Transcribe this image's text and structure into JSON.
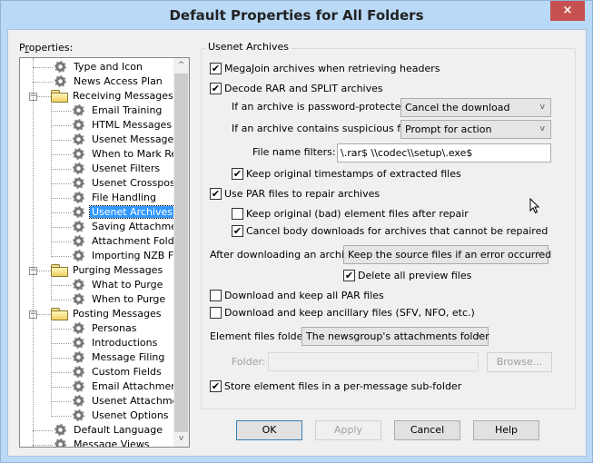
{
  "window": {
    "title": "Default Properties for All Folders",
    "close_label": "×"
  },
  "tree": {
    "label_prefix": "P",
    "label_underlined": "r",
    "label_suffix": "operties:",
    "items": [
      {
        "label": "Type and Icon",
        "icon": "gear-icon",
        "level": 0
      },
      {
        "label": "News Access Plan",
        "icon": "gear-icon",
        "level": 0
      },
      {
        "label": "Receiving Messages",
        "icon": "folder-icon",
        "level": 0,
        "expanded": true
      },
      {
        "label": "Email Training",
        "icon": "gear-icon",
        "level": 1
      },
      {
        "label": "HTML Messages",
        "icon": "gear-icon",
        "level": 1
      },
      {
        "label": "Usenet Messages",
        "icon": "gear-icon",
        "level": 1
      },
      {
        "label": "When to Mark Read",
        "icon": "gear-icon",
        "level": 1
      },
      {
        "label": "Usenet Filters",
        "icon": "gear-icon",
        "level": 1
      },
      {
        "label": "Usenet Crossposting",
        "icon": "gear-icon",
        "level": 1
      },
      {
        "label": "File Handling",
        "icon": "gear-icon",
        "level": 1
      },
      {
        "label": "Usenet Archives",
        "icon": "gear-icon",
        "level": 1,
        "selected": true
      },
      {
        "label": "Saving Attachments",
        "icon": "gear-icon",
        "level": 1
      },
      {
        "label": "Attachment Folders",
        "icon": "gear-icon",
        "level": 1
      },
      {
        "label": "Importing NZB Files",
        "icon": "gear-icon",
        "level": 1
      },
      {
        "label": "Purging Messages",
        "icon": "folder-icon",
        "level": 0,
        "expanded": true
      },
      {
        "label": "What to Purge",
        "icon": "gear-icon",
        "level": 1
      },
      {
        "label": "When to Purge",
        "icon": "gear-icon",
        "level": 1
      },
      {
        "label": "Posting Messages",
        "icon": "folder-icon",
        "level": 0,
        "expanded": true
      },
      {
        "label": "Personas",
        "icon": "gear-icon",
        "level": 1
      },
      {
        "label": "Introductions",
        "icon": "gear-icon",
        "level": 1
      },
      {
        "label": "Message Filing",
        "icon": "gear-icon",
        "level": 1
      },
      {
        "label": "Custom Fields",
        "icon": "gear-icon",
        "level": 1
      },
      {
        "label": "Email Attachments",
        "icon": "gear-icon",
        "level": 1
      },
      {
        "label": "Usenet Attachments",
        "icon": "gear-icon",
        "level": 1
      },
      {
        "label": "Usenet Options",
        "icon": "gear-icon",
        "level": 1
      },
      {
        "label": "Default Language",
        "icon": "gear-icon",
        "level": 0
      },
      {
        "label": "Message Views",
        "icon": "gear-icon",
        "level": 0
      }
    ],
    "expander_symbol": "−",
    "scroll_up": "^",
    "scroll_down": "v"
  },
  "panel": {
    "group_title": "Usenet Archives",
    "megajoin": {
      "label": "MegaJoin archives when retrieving headers",
      "checked": true
    },
    "decode_rar": {
      "label": "Decode RAR and SPLIT archives",
      "checked": true
    },
    "password_label": "If an archive is password-protected:",
    "password_value": "Cancel the download",
    "suspicious_label": "If an archive contains suspicious files:",
    "suspicious_value": "Prompt for action",
    "filters_label": "File name filters:",
    "filters_value": "\\.rar$ \\\\codec\\\\setup\\.exe$",
    "keep_timestamps": {
      "label": "Keep original timestamps of extracted files",
      "checked": true
    },
    "use_par": {
      "label": "Use PAR files to repair archives",
      "checked": true
    },
    "keep_bad": {
      "label": "Keep original (bad) element files after repair",
      "checked": false
    },
    "cancel_body": {
      "label": "Cancel body downloads for archives that cannot be repaired",
      "checked": true
    },
    "after_label": "After downloading an archive",
    "after_value": "Keep the source files if an error occurred",
    "delete_preview": {
      "label": "Delete all preview files",
      "checked": true
    },
    "download_par": {
      "label": "Download and keep all PAR files",
      "checked": false
    },
    "download_ancillary": {
      "label": "Download and keep ancillary files (SFV, NFO, etc.)",
      "checked": false
    },
    "element_folder_label": "Element files folder:",
    "element_folder_value": "The newsgroup's attachments folder",
    "folder_label": "Folder:",
    "folder_value": "",
    "browse_label": "Browse...",
    "store_subfolder": {
      "label": "Store element files in a per-message sub-folder",
      "checked": true
    },
    "check_mark": "✔",
    "chevron": "v"
  },
  "buttons": {
    "ok": "OK",
    "apply": "Apply",
    "cancel": "Cancel",
    "help": "Help"
  }
}
